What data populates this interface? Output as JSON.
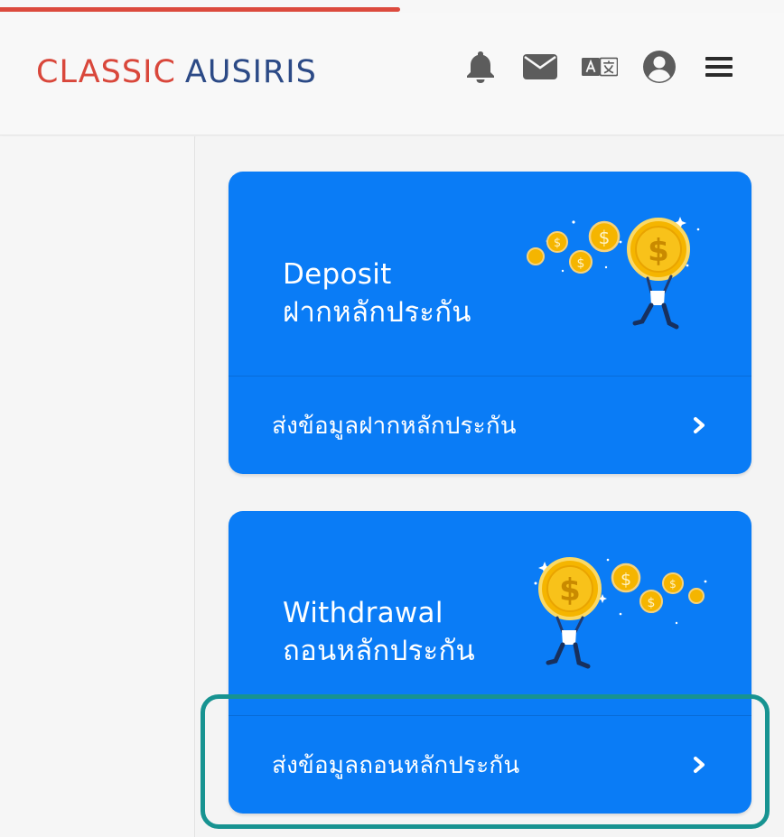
{
  "progress": {
    "value": 0.51
  },
  "header": {
    "brand_part1": "CLASSIC",
    "brand_part2": "AUSIRIS",
    "brand_colors": {
      "classic": "#d9473b",
      "ausiris": "#2c4a86"
    },
    "icons": [
      "bell-icon",
      "envelope-icon",
      "translate-icon",
      "user-circle-icon",
      "hamburger-menu-icon"
    ]
  },
  "cards": {
    "deposit": {
      "title_en": "Deposit",
      "title_th": "ฝากหลักประกัน",
      "action_label": "ส่งข้อมูลฝากหลักประกัน",
      "illustration": "person-lifting-coins"
    },
    "withdraw": {
      "title_en": "Withdrawal",
      "title_th": "ถอนหลักประกัน",
      "action_label": "ส่งข้อมูลถอนหลักประกัน",
      "illustration": "person-lifting-coins"
    }
  },
  "colors": {
    "card_blue": "#0a7cf6",
    "highlight": "#179391",
    "progress": "#dc4a3d",
    "coin_gold": "#f5b500"
  }
}
